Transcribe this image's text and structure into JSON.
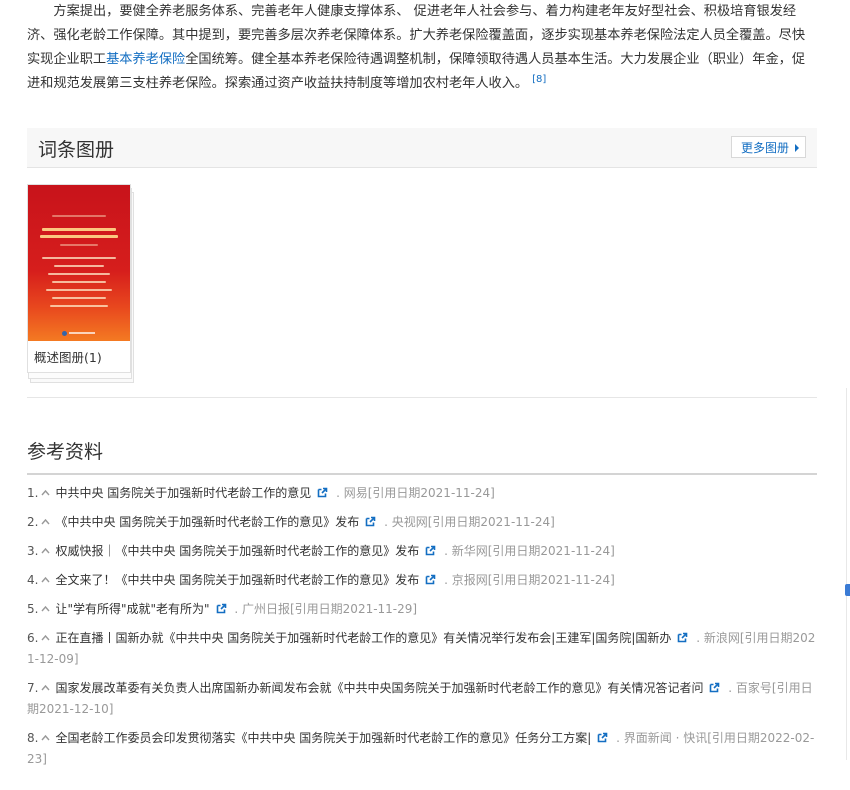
{
  "intro": {
    "text_before_link": "方案提出，要健全养老服务体系、完善老年人健康支撑体系、 促进老年人社会参与、着力构建老年友好型社会、积极培育银发经济、强化老龄工作保障。其中提到，要完善多层次养老保障体系。扩大养老保险覆盖面，逐步实现基本养老保险法定人员全覆盖。尽快实现企业职工",
    "link_text": "基本养老保险",
    "text_after_link": "全国统筹。健全基本养老保险待遇调整机制，保障领取待遇人员基本生活。大力发展企业（职业）年金，促进和规范发展第三支柱养老保险。探索通过资产收益扶持制度等增加农村老年人收入。",
    "citation": "[8]"
  },
  "album": {
    "title": "词条图册",
    "more_label": "更多图册",
    "card_label": "概述图册(1)"
  },
  "references": {
    "title": "参考资料",
    "items": [
      {
        "num": "1.",
        "title": "中共中央 国务院关于加强新时代老龄工作的意见",
        "source": " . 网易[引用日期2021-11-24]"
      },
      {
        "num": "2.",
        "title": "《中共中央 国务院关于加强新时代老龄工作的意见》发布",
        "source": " . 央视网[引用日期2021-11-24]"
      },
      {
        "num": "3.",
        "title": "权威快报｜《中共中央 国务院关于加强新时代老龄工作的意见》发布",
        "source": " . 新华网[引用日期2021-11-24]"
      },
      {
        "num": "4.",
        "title": "全文来了！《中共中央 国务院关于加强新时代老龄工作的意见》发布",
        "source": " . 京报网[引用日期2021-11-24]"
      },
      {
        "num": "5.",
        "title": "让\"学有所得\"成就\"老有所为\"",
        "source": " . 广州日报[引用日期2021-11-29]"
      },
      {
        "num": "6.",
        "title": "正在直播丨国新办就《中共中央 国务院关于加强新时代老龄工作的意见》有关情况举行发布会|王建军|国务院|国新办",
        "source": " . 新浪网[引用日期2021-12-09]"
      },
      {
        "num": "7.",
        "title": "国家发展改革委有关负责人出席国新办新闻发布会就《中共中央国务院关于加强新时代老龄工作的意见》有关情况答记者问",
        "source": " . 百家号[引用日期2021-12-10]"
      },
      {
        "num": "8.",
        "title": "全国老龄工作委员会印发贯彻落实《中共中央 国务院关于加强新时代老龄工作的意见》任务分工方案|",
        "source": " . 界面新闻 · 快讯[引用日期2022-02-23]"
      }
    ]
  },
  "colors": {
    "link": "#136ec2",
    "cover_red": "#c8131b",
    "cover_orange": "#f47a22"
  },
  "icons": {
    "up": "caret-up-icon",
    "external": "external-link-icon",
    "more_arrow": "triangle-right-icon"
  }
}
